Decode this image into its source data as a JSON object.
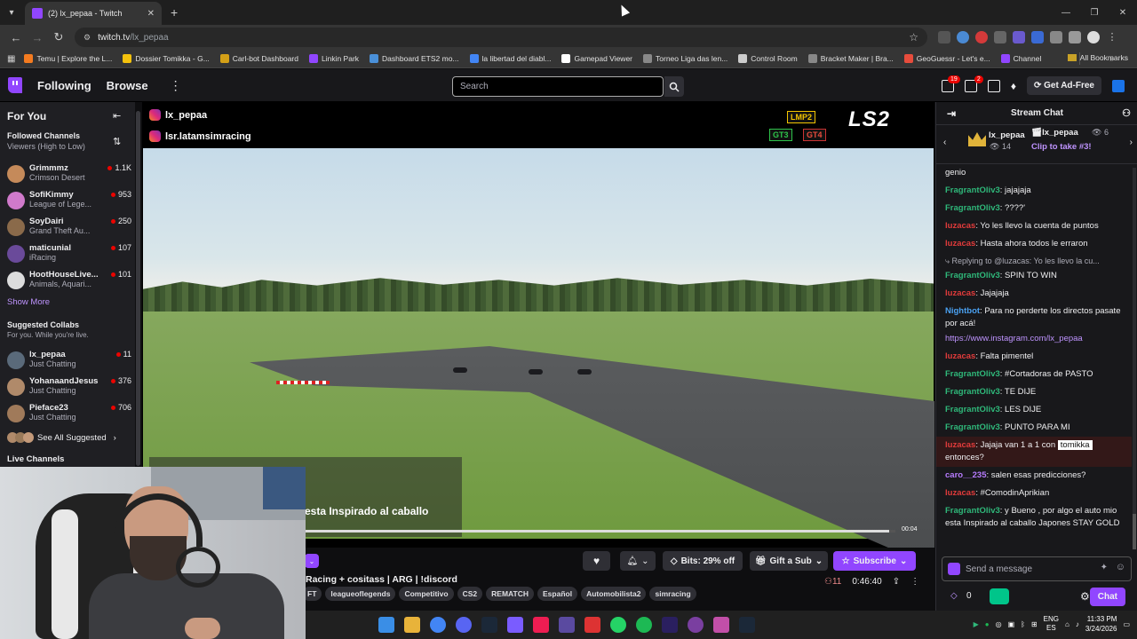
{
  "browser": {
    "tab_title": "(2) lx_pepaa - Twitch",
    "url_domain": "twitch.tv",
    "url_path": "/lx_pepaa",
    "bookmarks": [
      {
        "label": "Temu | Explore the L...",
        "color": "#f47b20"
      },
      {
        "label": "Dossier Tomikka - G...",
        "color": "#f4c20d"
      },
      {
        "label": "Carl-bot Dashboard",
        "color": "#d4a017"
      },
      {
        "label": "Linkin Park",
        "color": "#9146ff"
      },
      {
        "label": "Dashboard ETS2 mo...",
        "color": "#4a90d9"
      },
      {
        "label": "la libertad del diabl...",
        "color": "#4285f4"
      },
      {
        "label": "Gamepad Viewer",
        "color": "#ffffff"
      },
      {
        "label": "Torneo Liga das len...",
        "color": "#888888"
      },
      {
        "label": "Control Room",
        "color": "#cccccc"
      },
      {
        "label": "Bracket Maker | Bra...",
        "color": "#888888"
      },
      {
        "label": "GeoGuessr - Let's e...",
        "color": "#e74c3c"
      },
      {
        "label": "Channel",
        "color": "#9146ff"
      }
    ],
    "all_bookmarks": "All Bookmarks"
  },
  "topnav": {
    "following": "Following",
    "browse": "Browse",
    "search_placeholder": "Search",
    "notif_count": "19",
    "inbox_count": "2",
    "ad_free": "Get Ad-Free"
  },
  "sidebar": {
    "title": "For You",
    "followed_header": "Followed Channels",
    "followed_sort": "Viewers (High to Low)",
    "followed": [
      {
        "name": "Grimmmz",
        "game": "Crimson Desert",
        "viewers": "1.1K",
        "color": "#c58a5a"
      },
      {
        "name": "SofiKimmy",
        "game": "League of Lege...",
        "viewers": "953",
        "color": "#d07acb"
      },
      {
        "name": "SoyDairi",
        "game": "Grand Theft Au...",
        "viewers": "250",
        "color": "#8a6a4a"
      },
      {
        "name": "maticunial",
        "game": "iRacing",
        "viewers": "107",
        "color": "#6a4a9a"
      },
      {
        "name": "HootHouseLive...",
        "game": "Animals, Aquari...",
        "viewers": "101",
        "color": "#dddddd"
      }
    ],
    "show_more": "Show More",
    "collabs_header": "Suggested Collabs",
    "collabs_sub": "For you. While you're live.",
    "collabs": [
      {
        "name": "lx_pepaa",
        "game": "Just Chatting",
        "viewers": "11",
        "color": "#5a6a7a"
      },
      {
        "name": "YohanaandJesus",
        "game": "Just Chatting",
        "viewers": "376",
        "color": "#b08a6a"
      },
      {
        "name": "Pieface23",
        "game": "Just Chatting",
        "viewers": "706",
        "color": "#a07a5a"
      }
    ],
    "see_all": "See All Suggested",
    "live_header": "Live Channels"
  },
  "video": {
    "ig1": "lx_pepaa",
    "ig2": "lsr.latamsimracing",
    "class_lmp2": "LMP2",
    "class_gt3": "GT3",
    "class_gt4": "GT4",
    "logo": "LS2",
    "overlay_text": "esta Inspirado al caballo",
    "time": "00:04",
    "progress": 0.99
  },
  "info": {
    "stream_title": "Racing + cositass | ARG | !discord",
    "tags": [
      "FT",
      "leagueoflegends",
      "Competitivo",
      "CS2",
      "REMATCH",
      "Español",
      "Automobilista2",
      "simracing"
    ],
    "bits_label": "Bits: 29% off",
    "gift_label": "Gift a Sub",
    "subscribe_label": "Subscribe",
    "viewers": "11",
    "uptime": "0:46:40"
  },
  "chat": {
    "title": "Stream Chat",
    "pinned_user": "lx_pepaa",
    "pinned_count": "14",
    "pinned_user2": "lx_pepaa",
    "pinned_views": "6",
    "pinned_clip": "Clip to take #3!",
    "messages": [
      {
        "user": "",
        "color": "g",
        "text": "genio"
      },
      {
        "user": "FragrantOliv3",
        "color": "g",
        "text": ": jajajaja"
      },
      {
        "user": "FragrantOliv3",
        "color": "g",
        "text": ": ????'"
      },
      {
        "user": "luzacas",
        "color": "r",
        "text": ": Yo les llevo la cuenta de puntos"
      },
      {
        "user": "luzacas",
        "color": "r",
        "text": ": Hasta ahora todos le erraron"
      }
    ],
    "reply_note": "Replying to @luzacas: Yo les llevo la cu...",
    "messages2": [
      {
        "user": "FragrantOliv3",
        "color": "g",
        "text": ": SPIN TO WIN"
      },
      {
        "user": "luzacas",
        "color": "r",
        "text": ": Jajajaja"
      },
      {
        "user": "Nightbot",
        "color": "b",
        "text": ": Para no perderte los directos pasate por acá!"
      }
    ],
    "nightbot_link": "https://www.instagram.com/lx_pepaa",
    "messages3": [
      {
        "user": "luzacas",
        "color": "r",
        "text": ": Falta pimentel"
      },
      {
        "user": "FragrantOliv3",
        "color": "g",
        "text": ": #Cortadoras de PASTO"
      },
      {
        "user": "FragrantOliv3",
        "color": "g",
        "text": ": TE DIJE"
      },
      {
        "user": "FragrantOliv3",
        "color": "g",
        "text": ": LES DIJE"
      },
      {
        "user": "FragrantOliv3",
        "color": "g",
        "text": ": PUNTO PARA MI"
      }
    ],
    "hl_user": "luzacas",
    "hl_text": ": Jajaja van 1 a 1 con",
    "hl_mention": "tomikka",
    "hl_text2": "entonces?",
    "messages4": [
      {
        "user": "caro__235",
        "color": "p",
        "text": ": salen esas predicciones?"
      },
      {
        "user": "luzacas",
        "color": "r",
        "text": ": #ComodinAprikian"
      },
      {
        "user": "FragrantOliv3",
        "color": "g",
        "text": ": y Bueno , por algo el auto mio esta Inspirado al caballo Japones STAY GOLD"
      }
    ],
    "input_placeholder": "Send a message",
    "points": "0",
    "chat_button": "Chat"
  },
  "taskbar": {
    "lang1": "ENG",
    "lang2": "ES",
    "time": "11:33 PM",
    "date": "3/24/2026"
  }
}
